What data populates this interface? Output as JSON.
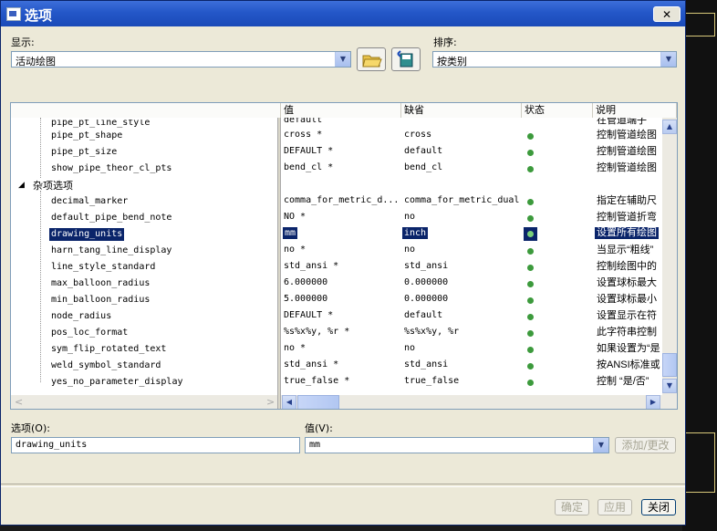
{
  "window": {
    "title": "选项",
    "close": "✕"
  },
  "display": {
    "label": "显示:",
    "value": "活动绘图"
  },
  "sort": {
    "label": "排序:",
    "value": "按类别"
  },
  "columns": {
    "value": "值",
    "default": "缺省",
    "status": "状态",
    "desc": "说明"
  },
  "tree": {
    "partial": "pipe_pt_line_style",
    "group_a": [
      "pipe_pt_shape",
      "pipe_pt_size",
      "show_pipe_theor_cl_pts"
    ],
    "group_title": "杂项选项",
    "group_b": [
      "decimal_marker",
      "default_pipe_bend_note",
      "drawing_units",
      "harn_tang_line_display",
      "line_style_standard",
      "max_balloon_radius",
      "min_balloon_radius",
      "node_radius",
      "pos_loc_format",
      "sym_flip_rotated_text",
      "weld_symbol_standard",
      "yes_no_parameter_display"
    ]
  },
  "rows": [
    {
      "value": "default",
      "default": "",
      "desc": "在管道端子"
    },
    {
      "value": "cross *",
      "default": "cross",
      "desc": "控制管道绘图"
    },
    {
      "value": "DEFAULT *",
      "default": "default",
      "desc": "控制管道绘图"
    },
    {
      "value": "bend_cl *",
      "default": "bend_cl",
      "desc": "控制管道绘图"
    },
    {
      "value": "",
      "default": "",
      "desc": ""
    },
    {
      "value": "comma_for_metric_d...",
      "default": "comma_for_metric_dual",
      "desc": "指定在辅助尺"
    },
    {
      "value": "NO *",
      "default": "no",
      "desc": "控制管道折弯"
    },
    {
      "value": "mm",
      "default": "inch",
      "desc": "设置所有绘图"
    },
    {
      "value": "no *",
      "default": "no",
      "desc": "当显示“粗线”"
    },
    {
      "value": "std_ansi *",
      "default": "std_ansi",
      "desc": "控制绘图中的"
    },
    {
      "value": "6.000000",
      "default": "0.000000",
      "desc": "设置球标最大"
    },
    {
      "value": "5.000000",
      "default": "0.000000",
      "desc": "设置球标最小"
    },
    {
      "value": "DEFAULT *",
      "default": "default",
      "desc": "设置显示在符"
    },
    {
      "value": "%s%x%y, %r *",
      "default": "%s%x%y, %r",
      "desc": "此字符串控制"
    },
    {
      "value": "no *",
      "default": "no",
      "desc": "如果设置为“是"
    },
    {
      "value": "std_ansi *",
      "default": "std_ansi",
      "desc": "按ANSI标准或"
    },
    {
      "value": "true_false *",
      "default": "true_false",
      "desc": "控制 “是/否”"
    }
  ],
  "option_field": {
    "label": "选项(O):",
    "value": "drawing_units"
  },
  "value_field": {
    "label": "值(V):",
    "value": "mm"
  },
  "buttons": {
    "add_change": "添加/更改",
    "ok": "确定",
    "apply": "应用",
    "close": "关闭"
  }
}
